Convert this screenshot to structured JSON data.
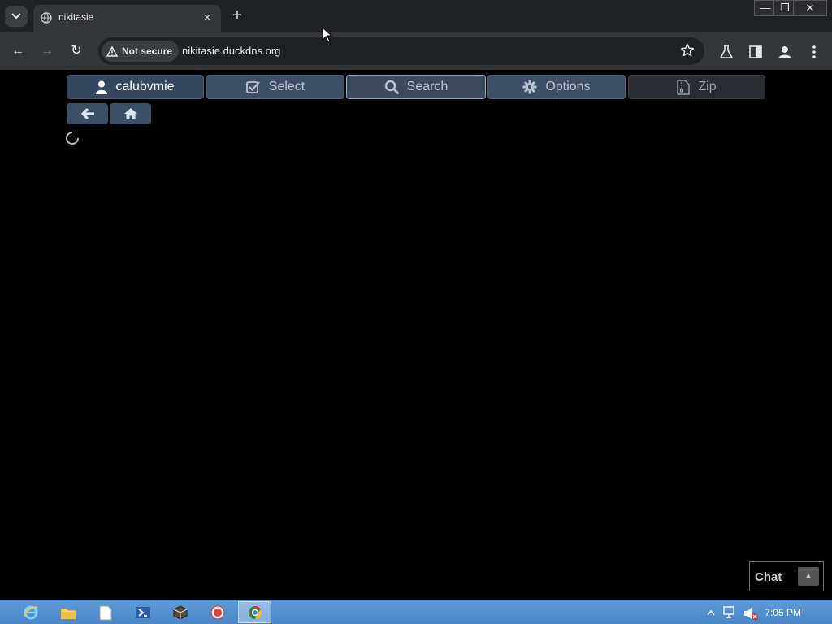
{
  "browser": {
    "tab_title": "nikitasie",
    "tab_close": "×",
    "new_tab": "+",
    "security_label": "Not secure",
    "url": "nikitasie.duckdns.org",
    "window_controls": {
      "minimize": "—",
      "restore": "❐",
      "close": "✕"
    }
  },
  "nav": {
    "back": "←",
    "forward": "→",
    "reload": "↻"
  },
  "page": {
    "buttons": {
      "user": "calubvmie",
      "select": "Select",
      "search": "Search",
      "options": "Options",
      "zip": "Zip"
    }
  },
  "chat": {
    "label": "Chat",
    "toggle": "▲"
  },
  "taskbar": {
    "clock": "7:05 PM"
  },
  "colors": {
    "page_bg": "#000000",
    "button": "#3d4f66",
    "taskbar": "#4a86c8"
  }
}
